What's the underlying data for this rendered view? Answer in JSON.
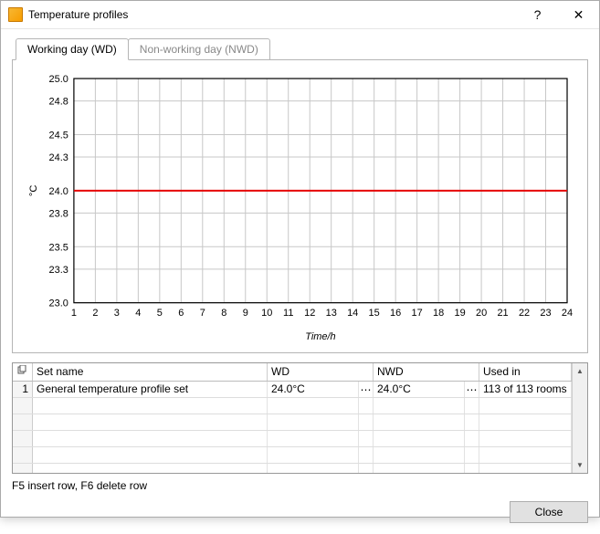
{
  "window": {
    "title": "Temperature profiles",
    "help_label": "?",
    "close_label": "✕"
  },
  "tabs": [
    {
      "label": "Working day (WD)",
      "active": true
    },
    {
      "label": "Non-working day (NWD)",
      "active": false
    }
  ],
  "chart_data": {
    "type": "line",
    "title": "",
    "xlabel": "Time/h",
    "ylabel": "°C",
    "xlim": [
      1,
      24
    ],
    "ylim": [
      23.0,
      25.0
    ],
    "xticks": [
      1,
      2,
      3,
      4,
      5,
      6,
      7,
      8,
      9,
      10,
      11,
      12,
      13,
      14,
      15,
      16,
      17,
      18,
      19,
      20,
      21,
      22,
      23,
      24
    ],
    "yticks": [
      23.0,
      23.3,
      23.5,
      23.8,
      24.0,
      24.3,
      24.5,
      24.8,
      25.0
    ],
    "series": [
      {
        "name": "WD",
        "color": "#e60000",
        "x": [
          1,
          2,
          3,
          4,
          5,
          6,
          7,
          8,
          9,
          10,
          11,
          12,
          13,
          14,
          15,
          16,
          17,
          18,
          19,
          20,
          21,
          22,
          23,
          24
        ],
        "values": [
          24.0,
          24.0,
          24.0,
          24.0,
          24.0,
          24.0,
          24.0,
          24.0,
          24.0,
          24.0,
          24.0,
          24.0,
          24.0,
          24.0,
          24.0,
          24.0,
          24.0,
          24.0,
          24.0,
          24.0,
          24.0,
          24.0,
          24.0,
          24.0
        ]
      }
    ]
  },
  "grid": {
    "headers": {
      "name": "Set name",
      "wd": "WD",
      "nwd": "NWD",
      "used": "Used in"
    },
    "rows": [
      {
        "num": "1",
        "name": "General temperature profile set",
        "wd": "24.0°C",
        "nwd": "24.0°C",
        "used": "113 of 113 rooms"
      }
    ],
    "empty_rows": 5
  },
  "hint": "F5 insert row, F6 delete row",
  "footer": {
    "close": "Close"
  }
}
